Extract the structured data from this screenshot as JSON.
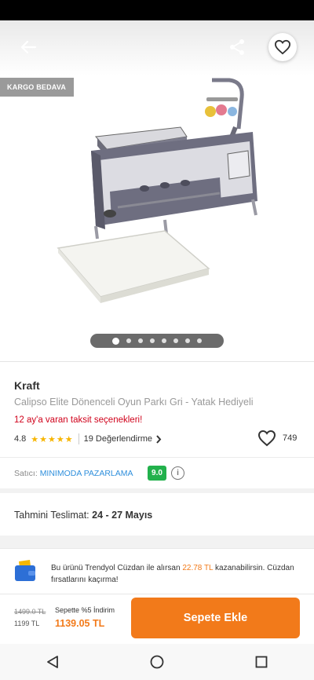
{
  "header": {
    "back_icon": "arrow-left-icon",
    "share_icon": "share-icon",
    "favorite_icon": "heart-outline-icon"
  },
  "hero": {
    "badge": "KARGO BEDAVA",
    "image": "baby-playpen-with-mattress",
    "carousel_total": 8,
    "carousel_active": 1
  },
  "product": {
    "brand": "Kraft",
    "title": "Calipso Elite Dönenceli Oyun Parkı Gri - Yatak Hediyeli",
    "installment": "12 ay'a varan taksit seçenekleri!",
    "rating": "4.8",
    "stars": "★★★★★",
    "reviews": "19 Değerlendirme",
    "likes": "749"
  },
  "seller": {
    "label": "Satıcı:",
    "name": "MINIMODA PAZARLAMA",
    "score": "9.0",
    "info_icon": "info-icon"
  },
  "delivery": {
    "label": "Tahmini Teslimat:",
    "dates": "24 - 27 Mayıs"
  },
  "wallet": {
    "text_before": "Bu ürünü Trendyol Cüzdan ile alırsan ",
    "amount": "22.78 TL",
    "text_after": " kazanabilirsin. Cüzdan fırsatlarını kaçırma!"
  },
  "cart": {
    "old_price": "1499.0 TL",
    "list_price": "1199 TL",
    "campaign": "Sepette %5 İndirim",
    "final_price": "1139.05 TL",
    "button": "Sepete Ekle"
  },
  "colors": {
    "accent": "#f27a1a",
    "seller_link": "#2f8fdc",
    "score_green": "#22b14c",
    "installment_red": "#d0021b",
    "star": "#f7b500"
  }
}
